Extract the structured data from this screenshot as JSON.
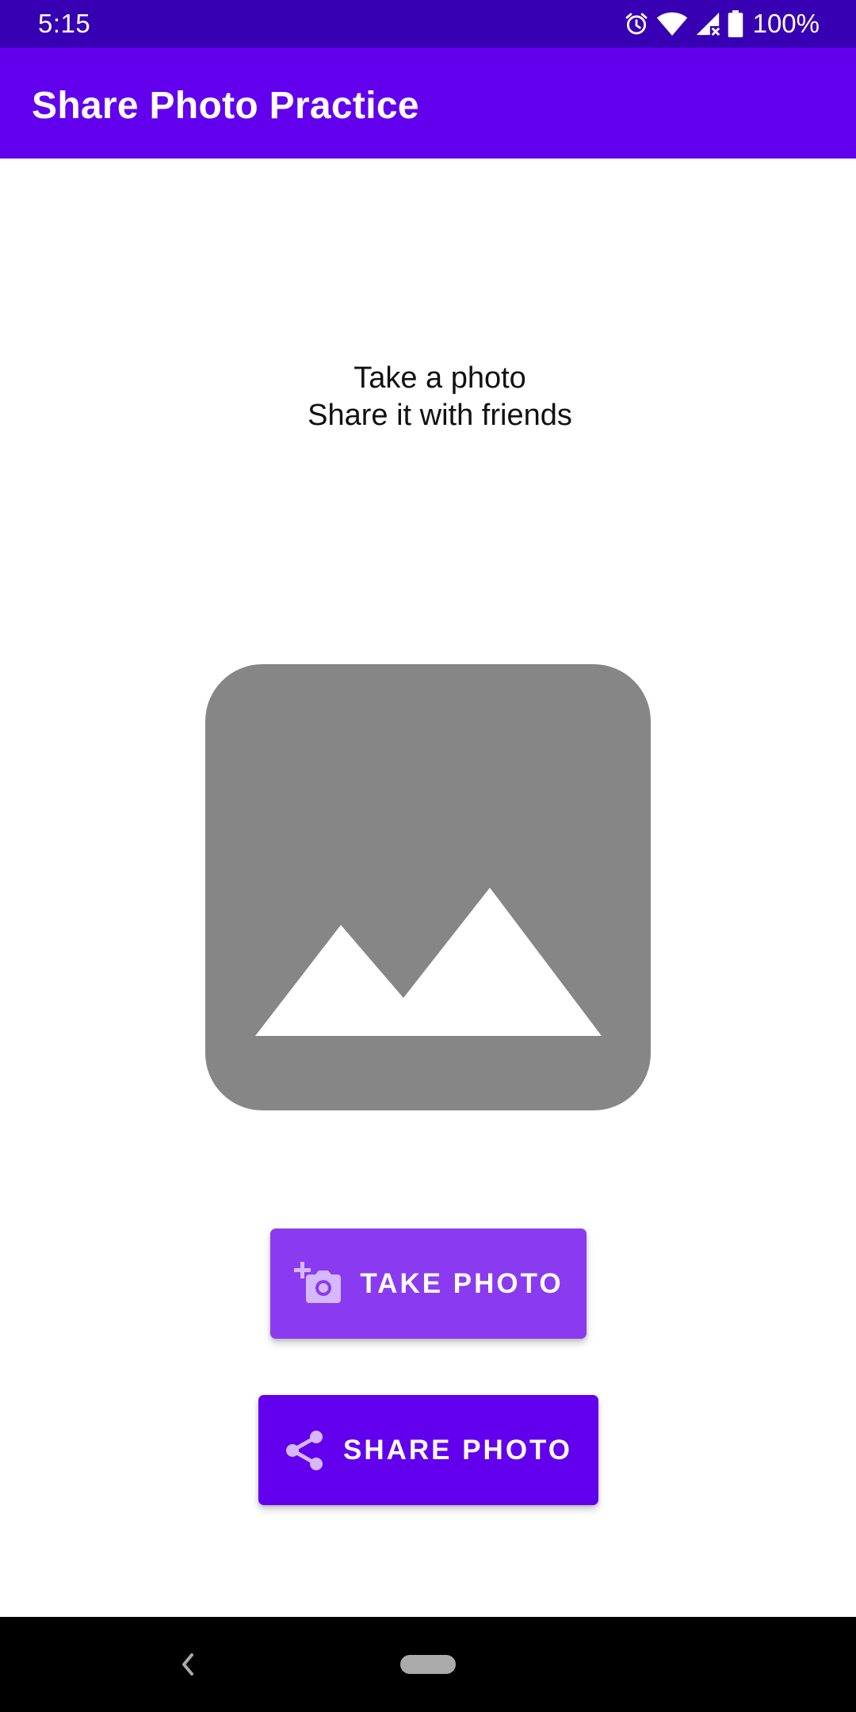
{
  "status_bar": {
    "time": "5:15",
    "battery": "100%",
    "icons": [
      "alarm-icon",
      "wifi-icon",
      "signal-icon",
      "battery-icon"
    ]
  },
  "app_bar": {
    "title": "Share Photo Practice"
  },
  "main": {
    "instruction_line1": "Take a photo",
    "instruction_line2": "Share it with friends",
    "placeholder_icon": "image-placeholder-icon"
  },
  "buttons": {
    "take_photo": {
      "label": "TAKE PHOTO",
      "icon": "add-camera-icon"
    },
    "share_photo": {
      "label": "SHARE PHOTO",
      "icon": "share-icon"
    }
  },
  "nav_bar": {
    "icons": [
      "back-icon",
      "home-pill-icon"
    ]
  },
  "colors": {
    "status_bar": "#3700b3",
    "primary": "#6200ee",
    "take_button": "#8a3bef",
    "placeholder": "#868686"
  }
}
